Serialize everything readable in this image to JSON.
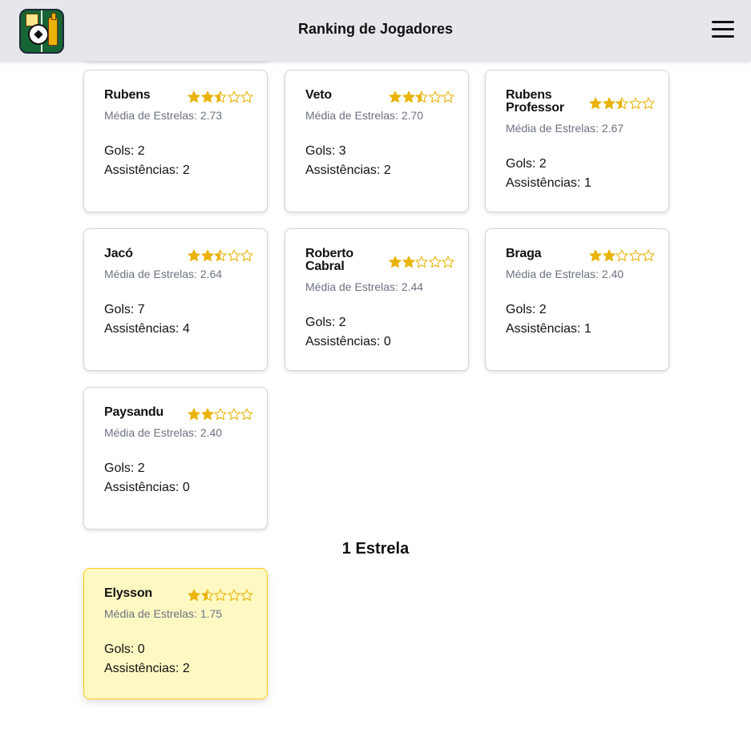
{
  "header": {
    "title": "Ranking de Jogadores"
  },
  "labels": {
    "avg_prefix": "Média de Estrelas: ",
    "goals_prefix": "Gols: ",
    "assists_prefix": "Assistências: "
  },
  "players": [
    {
      "name": "Rubens",
      "rating": 2.73,
      "avg_text": "Média de Estrelas: 2.73",
      "goals_text": "Gols: 2",
      "assists_text": "Assistências: 2"
    },
    {
      "name": "Veto",
      "rating": 2.7,
      "avg_text": "Média de Estrelas: 2.70",
      "goals_text": "Gols: 3",
      "assists_text": "Assistências: 2"
    },
    {
      "name": "Rubens Professor",
      "rating": 2.67,
      "avg_text": "Média de Estrelas: 2.67",
      "goals_text": "Gols: 2",
      "assists_text": "Assistências: 1"
    },
    {
      "name": "Jacó",
      "rating": 2.64,
      "avg_text": "Média de Estrelas: 2.64",
      "goals_text": "Gols: 7",
      "assists_text": "Assistências: 4"
    },
    {
      "name": "Roberto Cabral",
      "rating": 2.44,
      "avg_text": "Média de Estrelas: 2.44",
      "goals_text": "Gols: 2",
      "assists_text": "Assistências: 0"
    },
    {
      "name": "Braga",
      "rating": 2.4,
      "avg_text": "Média de Estrelas: 2.40",
      "goals_text": "Gols: 2",
      "assists_text": "Assistências: 1"
    },
    {
      "name": "Paysandu",
      "rating": 2.4,
      "avg_text": "Média de Estrelas: 2.40",
      "goals_text": "Gols: 2",
      "assists_text": "Assistências: 0"
    }
  ],
  "section_one_star": {
    "title": "1 Estrela",
    "players": [
      {
        "name": "Elysson",
        "rating": 1.75,
        "avg_text": "Média de Estrelas: 1.75",
        "goals_text": "Gols: 0",
        "assists_text": "Assistências: 2"
      }
    ]
  },
  "colors": {
    "star": "#eab308",
    "highlight_card": "#fef9c3",
    "highlight_border": "#facc15",
    "header_bg": "#e5e7eb"
  },
  "icons": {
    "logo": "beer-soccer-logo-icon",
    "menu": "hamburger-menu-icon"
  }
}
